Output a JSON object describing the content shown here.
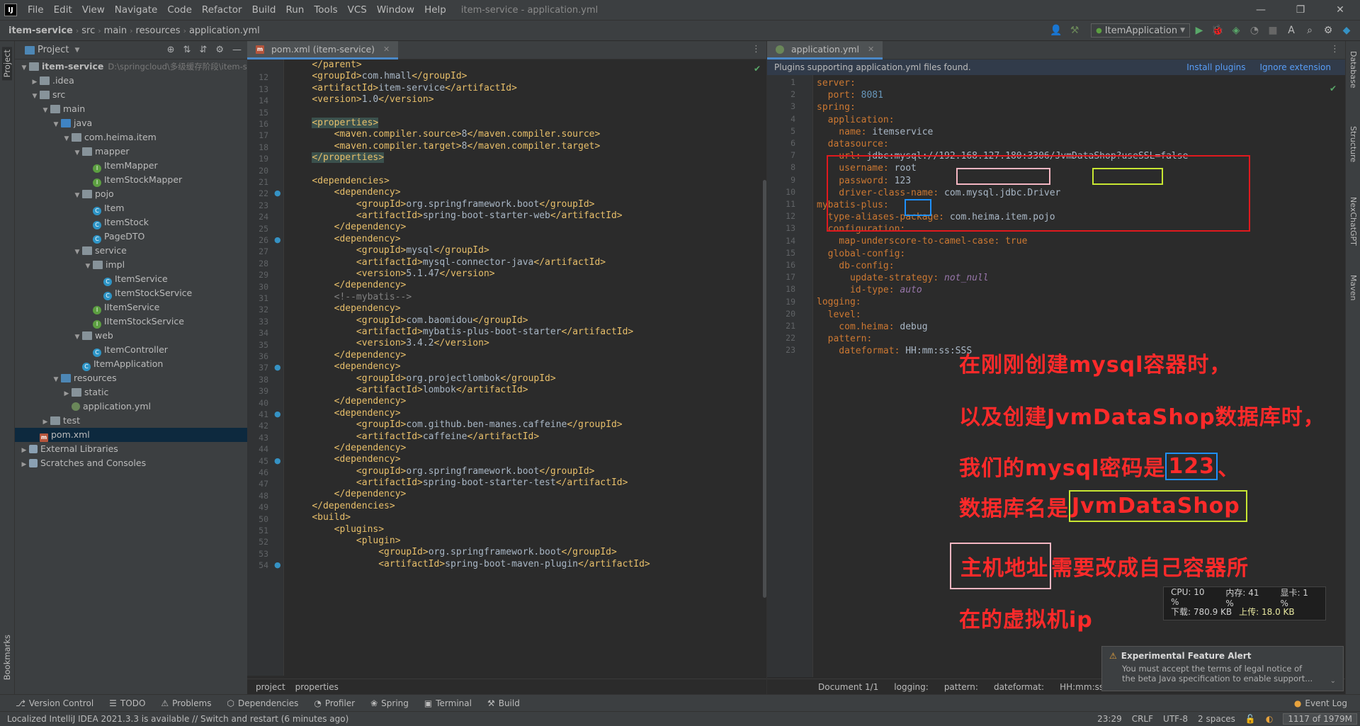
{
  "menu": {
    "items": [
      "File",
      "Edit",
      "View",
      "Navigate",
      "Code",
      "Refactor",
      "Build",
      "Run",
      "Tools",
      "VCS",
      "Window",
      "Help"
    ],
    "window_title": "item-service - application.yml"
  },
  "navbar": {
    "crumbs": [
      "item-service",
      "src",
      "main",
      "resources",
      "application.yml"
    ],
    "run_config": "ItemApplication"
  },
  "project": {
    "header": "Project",
    "tree": [
      {
        "label": "item-service",
        "extra": "D:\\springcloud\\多级缓存阶段\\item-s",
        "depth": 0,
        "icon": "folder",
        "open": true,
        "bold": true
      },
      {
        "label": ".idea",
        "depth": 1,
        "icon": "folder",
        "open": false
      },
      {
        "label": "src",
        "depth": 1,
        "icon": "folder",
        "open": true
      },
      {
        "label": "main",
        "depth": 2,
        "icon": "folder",
        "open": true
      },
      {
        "label": "java",
        "depth": 3,
        "icon": "src",
        "open": true
      },
      {
        "label": "com.heima.item",
        "depth": 4,
        "icon": "folder",
        "open": true
      },
      {
        "label": "mapper",
        "depth": 5,
        "icon": "folder",
        "open": true
      },
      {
        "label": "ItemMapper",
        "depth": 6,
        "icon": "intf",
        "leaf": true
      },
      {
        "label": "ItemStockMapper",
        "depth": 6,
        "icon": "intf",
        "leaf": true
      },
      {
        "label": "pojo",
        "depth": 5,
        "icon": "folder",
        "open": true
      },
      {
        "label": "Item",
        "depth": 6,
        "icon": "cls",
        "leaf": true
      },
      {
        "label": "ItemStock",
        "depth": 6,
        "icon": "cls",
        "leaf": true
      },
      {
        "label": "PageDTO",
        "depth": 6,
        "icon": "cls",
        "leaf": true
      },
      {
        "label": "service",
        "depth": 5,
        "icon": "folder",
        "open": true
      },
      {
        "label": "impl",
        "depth": 6,
        "icon": "folder",
        "open": true
      },
      {
        "label": "ItemService",
        "depth": 7,
        "icon": "cls",
        "leaf": true
      },
      {
        "label": "ItemStockService",
        "depth": 7,
        "icon": "cls",
        "leaf": true
      },
      {
        "label": "IItemService",
        "depth": 6,
        "icon": "intf",
        "leaf": true
      },
      {
        "label": "IItemStockService",
        "depth": 6,
        "icon": "intf",
        "leaf": true
      },
      {
        "label": "web",
        "depth": 5,
        "icon": "folder",
        "open": true
      },
      {
        "label": "ItemController",
        "depth": 6,
        "icon": "cls",
        "leaf": true
      },
      {
        "label": "ItemApplication",
        "depth": 5,
        "icon": "cls",
        "leaf": true
      },
      {
        "label": "resources",
        "depth": 3,
        "icon": "blue",
        "open": true
      },
      {
        "label": "static",
        "depth": 4,
        "icon": "folder",
        "open": false
      },
      {
        "label": "application.yml",
        "depth": 4,
        "icon": "yml",
        "leaf": true
      },
      {
        "label": "test",
        "depth": 2,
        "icon": "folder",
        "open": false
      },
      {
        "label": "pom.xml",
        "depth": 1,
        "icon": "mvn",
        "leaf": true,
        "selected": true
      },
      {
        "label": "External Libraries",
        "depth": 0,
        "icon": "lib",
        "open": false
      },
      {
        "label": "Scratches and Consoles",
        "depth": 0,
        "icon": "lib",
        "open": false
      }
    ]
  },
  "pom_tab": "pom.xml (item-service)",
  "pom_lines": [
    {
      "n": "",
      "t": "    </parent>"
    },
    {
      "n": "12",
      "t": "    <groupId>com.hmall</groupId>"
    },
    {
      "n": "13",
      "t": "    <artifactId>item-service</artifactId>"
    },
    {
      "n": "14",
      "t": "    <version>1.0</version>"
    },
    {
      "n": "15",
      "t": ""
    },
    {
      "n": "16",
      "t": "    <properties>"
    },
    {
      "n": "17",
      "t": "        <maven.compiler.source>8</maven.compiler.source>"
    },
    {
      "n": "18",
      "t": "        <maven.compiler.target>8</maven.compiler.target>"
    },
    {
      "n": "19",
      "t": "    </properties>"
    },
    {
      "n": "20",
      "t": ""
    },
    {
      "n": "21",
      "t": "    <dependencies>"
    },
    {
      "n": "22",
      "t": "        <dependency>"
    },
    {
      "n": "23",
      "t": "            <groupId>org.springframework.boot</groupId>"
    },
    {
      "n": "24",
      "t": "            <artifactId>spring-boot-starter-web</artifactId>"
    },
    {
      "n": "25",
      "t": "        </dependency>"
    },
    {
      "n": "26",
      "t": "        <dependency>"
    },
    {
      "n": "27",
      "t": "            <groupId>mysql</groupId>"
    },
    {
      "n": "28",
      "t": "            <artifactId>mysql-connector-java</artifactId>"
    },
    {
      "n": "29",
      "t": "            <version>5.1.47</version>"
    },
    {
      "n": "30",
      "t": "        </dependency>"
    },
    {
      "n": "31",
      "t": "        <!--mybatis-->"
    },
    {
      "n": "32",
      "t": "        <dependency>"
    },
    {
      "n": "33",
      "t": "            <groupId>com.baomidou</groupId>"
    },
    {
      "n": "34",
      "t": "            <artifactId>mybatis-plus-boot-starter</artifactId>"
    },
    {
      "n": "35",
      "t": "            <version>3.4.2</version>"
    },
    {
      "n": "36",
      "t": "        </dependency>"
    },
    {
      "n": "37",
      "t": "        <dependency>"
    },
    {
      "n": "38",
      "t": "            <groupId>org.projectlombok</groupId>"
    },
    {
      "n": "39",
      "t": "            <artifactId>lombok</artifactId>"
    },
    {
      "n": "40",
      "t": "        </dependency>"
    },
    {
      "n": "41",
      "t": "        <dependency>"
    },
    {
      "n": "42",
      "t": "            <groupId>com.github.ben-manes.caffeine</groupId>"
    },
    {
      "n": "43",
      "t": "            <artifactId>caffeine</artifactId>"
    },
    {
      "n": "44",
      "t": "        </dependency>"
    },
    {
      "n": "45",
      "t": "        <dependency>"
    },
    {
      "n": "46",
      "t": "            <groupId>org.springframework.boot</groupId>"
    },
    {
      "n": "47",
      "t": "            <artifactId>spring-boot-starter-test</artifactId>"
    },
    {
      "n": "48",
      "t": "        </dependency>"
    },
    {
      "n": "49",
      "t": "    </dependencies>"
    },
    {
      "n": "50",
      "t": "    <build>"
    },
    {
      "n": "51",
      "t": "        <plugins>"
    },
    {
      "n": "52",
      "t": "            <plugin>"
    },
    {
      "n": "53",
      "t": "                <groupId>org.springframework.boot</groupId>"
    },
    {
      "n": "54",
      "t": "                <artifactId>spring-boot-maven-plugin</artifactId>"
    }
  ],
  "pom_crumbs": [
    "project",
    "properties"
  ],
  "yml_tab": "application.yml",
  "banner": {
    "text": "Plugins supporting application.yml files found.",
    "install": "Install plugins",
    "ignore": "Ignore extension"
  },
  "yml_lines": [
    {
      "n": "1",
      "k": "server:",
      "v": "",
      "ind": 0
    },
    {
      "n": "2",
      "k": "port: ",
      "v": "8081",
      "ind": 1,
      "num": true
    },
    {
      "n": "3",
      "k": "spring:",
      "v": "",
      "ind": 0
    },
    {
      "n": "4",
      "k": "application:",
      "v": "",
      "ind": 1
    },
    {
      "n": "5",
      "k": "name: ",
      "v": "itemservice",
      "ind": 2
    },
    {
      "n": "6",
      "k": "datasource:",
      "v": "",
      "ind": 1
    },
    {
      "n": "7",
      "k": "url: ",
      "v": "jdbc:mysql://192.168.127.180:3306/JvmDataShop?useSSL=false",
      "ind": 2
    },
    {
      "n": "8",
      "k": "username: ",
      "v": "root",
      "ind": 2
    },
    {
      "n": "9",
      "k": "password: ",
      "v": "123",
      "ind": 2
    },
    {
      "n": "10",
      "k": "driver-class-name: ",
      "v": "com.mysql.jdbc.Driver",
      "ind": 2
    },
    {
      "n": "11",
      "k": "mybatis-plus:",
      "v": "",
      "ind": 0
    },
    {
      "n": "12",
      "k": "type-aliases-package: ",
      "v": "com.heima.item.pojo",
      "ind": 1
    },
    {
      "n": "13",
      "k": "configuration:",
      "v": "",
      "ind": 1
    },
    {
      "n": "14",
      "k": "map-underscore-to-camel-case: ",
      "v": "true",
      "ind": 2,
      "kw": true
    },
    {
      "n": "15",
      "k": "global-config:",
      "v": "",
      "ind": 1
    },
    {
      "n": "16",
      "k": "db-config:",
      "v": "",
      "ind": 2
    },
    {
      "n": "17",
      "k": "update-strategy: ",
      "v": "not_null",
      "ind": 3,
      "it": true
    },
    {
      "n": "18",
      "k": "id-type: ",
      "v": "auto",
      "ind": 3,
      "it": true
    },
    {
      "n": "19",
      "k": "logging:",
      "v": "",
      "ind": 0
    },
    {
      "n": "20",
      "k": "level:",
      "v": "",
      "ind": 1
    },
    {
      "n": "21",
      "k": "com.heima: ",
      "v": "debug",
      "ind": 2
    },
    {
      "n": "22",
      "k": "pattern:",
      "v": "",
      "ind": 1
    },
    {
      "n": "23",
      "k": "dateformat: ",
      "v": "HH:mm:ss:SSS",
      "ind": 2
    }
  ],
  "yml_crumbs": [
    "Document 1/1",
    "logging:",
    "pattern:",
    "dateformat:",
    "HH:mm:ss:SSS"
  ],
  "annotation": {
    "line1": "在刚刚创建mysql容器时，",
    "line2": "以及创建JvmDataShop数据库时，",
    "line3_a": "我们的mysql密码是",
    "line3_b": "123",
    "line3_c": "、",
    "line4_a": "数据库名是",
    "line4_b": "JvmDataShop",
    "line5_a": "主机地址",
    "line5_b": "需要改成自己容器所",
    "line6": "在的虚拟机ip"
  },
  "perf": {
    "cpu": "CPU: 10 %",
    "mem": "内存: 41 %",
    "gpu": "显卡: 1 %",
    "down": "下载: 780.9 KB",
    "up": "上传: 18.0 KB"
  },
  "alert": {
    "title": "Experimental Feature Alert",
    "body1": "You must accept the terms of legal notice of",
    "body2": "the beta Java specification to enable support..."
  },
  "toolwindows": [
    "Version Control",
    "TODO",
    "Problems",
    "Dependencies",
    "Profiler",
    "Spring",
    "Terminal",
    "Build"
  ],
  "event_log": "Event Log",
  "status": {
    "message": "Localized IntelliJ IDEA 2021.3.3 is available // Switch and restart (6 minutes ago)",
    "pos": "23:29",
    "crlf": "CRLF",
    "enc": "UTF-8",
    "indent": "2 spaces",
    "mem": "1117 of 1979M"
  },
  "left_tabs": [
    "Project",
    "Bookmarks"
  ],
  "right_tabs": [
    "Database",
    "Structure",
    "NexChatGPT",
    "Maven"
  ],
  "colors": {
    "annotation_red": "#ff2a2a",
    "box_pink": "#f4b6c2",
    "box_green": "#c8e632",
    "box_blue": "#1e90ff"
  }
}
